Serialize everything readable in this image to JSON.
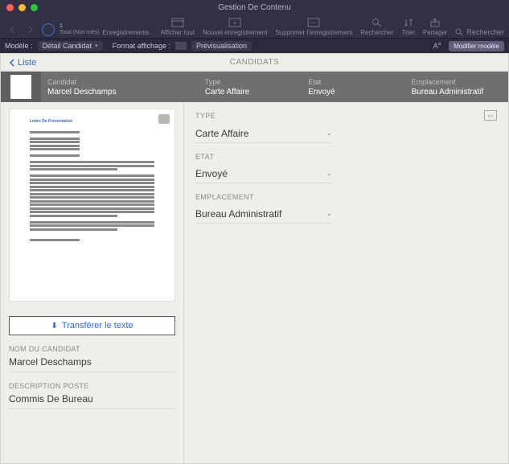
{
  "window": {
    "title": "Gestion De Contenu"
  },
  "toolbar": {
    "records_count": "1",
    "records_sub": "Total (Non triés)",
    "records_label": "Enregistrements",
    "show_all": "Afficher tout",
    "new_record": "Nouvel enregistrement",
    "delete_record": "Supprimer l'enregistrement",
    "find": "Rechercher",
    "sort": "Trier",
    "share": "Partager",
    "search_placeholder": "Rechercher"
  },
  "subbar": {
    "model_label": "Modèle :",
    "model_value": "Détail Candidat",
    "format_label": "Format affichage :",
    "preview": "Prévisualisation",
    "modify": "Modifier modèle"
  },
  "nav": {
    "back": "Liste",
    "center": "CANDIDATS"
  },
  "header": {
    "candidat_label": "Candidat",
    "candidat_value": "Marcel Deschamps",
    "type_label": "Type",
    "type_value": "Carte Affaire",
    "etat_label": "Etat",
    "etat_value": "Envoyé",
    "emplacement_label": "Emplacement",
    "emplacement_value": "Bureau Administratif"
  },
  "preview": {
    "title": "Lettre De Présentation"
  },
  "left": {
    "transfer": "Transférer le texte",
    "name_label": "NOM DU CANDIDAT",
    "name_value": "Marcel Deschamps",
    "desc_label": "DESCRIPTION POSTE",
    "desc_value": "Commis De Bureau"
  },
  "right": {
    "type_label": "TYPE",
    "type_value": "Carte Affaire",
    "etat_label": "ETAT",
    "etat_value": "Envoyé",
    "emplacement_label": "EMPLACEMENT",
    "emplacement_value": "Bureau Administratif"
  }
}
